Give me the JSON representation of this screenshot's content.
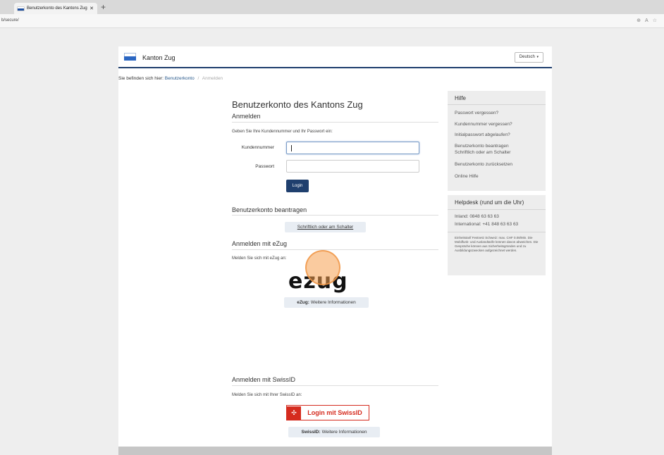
{
  "browser": {
    "tab_title": "Benutzerkonto des Kantons Zug",
    "tab_close": "✕",
    "new_tab": "+",
    "url": "b/secure/",
    "icons": [
      "zoom-icon",
      "read-aloud-icon",
      "favorite-icon"
    ]
  },
  "header": {
    "site_title": "Kanton Zug",
    "language": "Deutsch",
    "language_caret": "▾",
    "brand_color": "#1f3f6e"
  },
  "breadcrumb": {
    "prefix": "Sie befinden sich hier:",
    "link": "Benutzerkonto",
    "separator": "/",
    "current": "Anmelden"
  },
  "main": {
    "title": "Benutzerkonto des Kantons Zug",
    "login_section": {
      "title": "Anmelden",
      "instruction": "Geben Sie Ihre Kundennummer und Ihr Passwort ein:",
      "customer_label": "Kundennummer",
      "customer_value": "",
      "password_label": "Passwort",
      "password_value": "",
      "login_button": "Login"
    },
    "register_section": {
      "title": "Benutzerkonto beantragen",
      "link": "Schriftlich oder am Schalter"
    },
    "ezug_section": {
      "title": "Anmelden mit eZug",
      "instruction": "Melden Sie sich mit eZug an:",
      "logo_text": "ezug",
      "info_bold": "eZug:",
      "info_text": "Weitere Informationen"
    },
    "swissid_section": {
      "title": "Anmelden mit SwissID",
      "instruction": "Melden Sie sich mit Ihrer SwissID an:",
      "button_label": "Login mit SwissID",
      "info_bold": "SwissID:",
      "info_text": "Weitere Informationen"
    }
  },
  "sidebar": {
    "help": {
      "title": "Hilfe",
      "links": [
        "Passwort vergessen?",
        "Kundennummer vergessen?",
        "Initialpasswort abgelaufen?",
        "Benutzerkonto beantragen",
        "Schriftlich oder am Schalter",
        "Benutzerkonto zurücksetzen",
        "Online Hilfe"
      ]
    },
    "helpdesk": {
      "title": "Helpdesk (rund um die Uhr)",
      "inland": "Inland: 0848 63 63 63",
      "international": "International: +41 848 63 63 63",
      "fine_print": "Einheitstarif Festnetz Schweiz: max. CHF 0.08/Min. Die Mobilfunk- und Auslandtarife können davon abweichen. Die Gespräche können aus Sicherheitsgründen und zu Ausbildungszwecken aufgezeichnet werden."
    }
  }
}
